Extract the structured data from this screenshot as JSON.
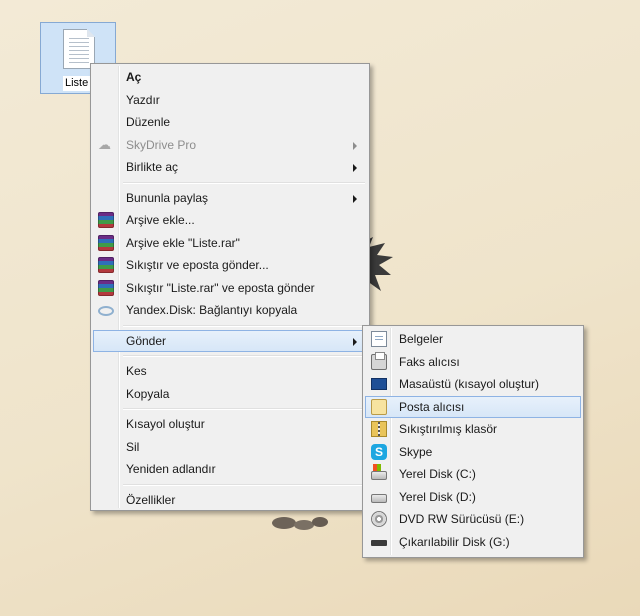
{
  "desktop": {
    "file_label": "Liste"
  },
  "context_menu": {
    "groups": [
      [
        {
          "label": "Aç",
          "bold": true
        },
        {
          "label": "Yazdır"
        },
        {
          "label": "Düzenle"
        },
        {
          "label": "SkyDrive Pro",
          "disabled": true,
          "submenu": true,
          "icon": "cloud-icon"
        },
        {
          "label": "Birlikte aç",
          "submenu": true
        }
      ],
      [
        {
          "label": "Bununla paylaş",
          "submenu": true
        },
        {
          "label": "Arşive ekle...",
          "icon": "winrar-icon"
        },
        {
          "label": "Arşive ekle \"Liste.rar\"",
          "icon": "winrar-icon"
        },
        {
          "label": "Sıkıştır ve eposta gönder...",
          "icon": "winrar-icon"
        },
        {
          "label": "Sıkıştır \"Liste.rar\" ve eposta gönder",
          "icon": "winrar-icon"
        },
        {
          "label": "Yandex.Disk: Bağlantıyı kopyala",
          "icon": "yandex-disk-icon"
        }
      ],
      [
        {
          "label": "Gönder",
          "submenu": true,
          "highlighted": true
        }
      ],
      [
        {
          "label": "Kes"
        },
        {
          "label": "Kopyala"
        }
      ],
      [
        {
          "label": "Kısayol oluştur"
        },
        {
          "label": "Sil"
        },
        {
          "label": "Yeniden adlandır"
        }
      ],
      [
        {
          "label": "Özellikler"
        }
      ]
    ]
  },
  "sendto_menu": {
    "items": [
      {
        "label": "Belgeler",
        "icon": "documents-icon"
      },
      {
        "label": "Faks alıcısı",
        "icon": "fax-icon"
      },
      {
        "label": "Masaüstü (kısayol oluştur)",
        "icon": "desktop-icon"
      },
      {
        "label": "Posta alıcısı",
        "icon": "mail-icon",
        "highlighted": true
      },
      {
        "label": "Sıkıştırılmış klasör",
        "icon": "zip-folder-icon"
      },
      {
        "label": "Skype",
        "icon": "skype-icon"
      },
      {
        "label": "Yerel Disk (C:)",
        "icon": "system-drive-icon"
      },
      {
        "label": "Yerel Disk (D:)",
        "icon": "drive-icon"
      },
      {
        "label": "DVD RW Sürücüsü (E:)",
        "icon": "dvd-drive-icon"
      },
      {
        "label": "Çıkarılabilir Disk (G:)",
        "icon": "removable-drive-icon"
      }
    ]
  },
  "colors": {
    "menu_background": "#f0f0f0",
    "highlight": "#d6e6f7",
    "highlight_border": "#8eb3e4",
    "disabled_text": "#8d8d8d"
  }
}
